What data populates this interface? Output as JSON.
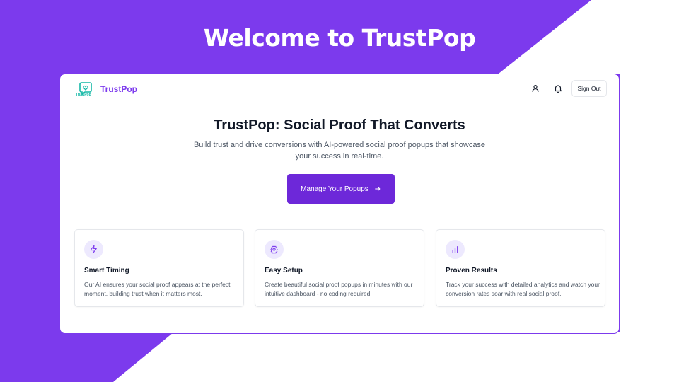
{
  "colors": {
    "accent": "#7c3aed",
    "accent_dark": "#6d28d9",
    "teal": "#14b8a6",
    "icon_bg": "#ede9fe"
  },
  "hero": {
    "title": "Welcome to TrustPop"
  },
  "header": {
    "logo_text": "TrustPop",
    "brand": "TrustPop",
    "icons": [
      "user-icon",
      "bell-icon"
    ],
    "sign_out": "Sign Out"
  },
  "main": {
    "heading": "TrustPop: Social Proof That Converts",
    "subheading": "Build trust and drive conversions with AI-powered social proof popups that showcase your success in real-time.",
    "cta_label": "Manage Your Popups",
    "cta_icon": "arrow-right-icon"
  },
  "features": [
    {
      "icon": "zap-icon",
      "title": "Smart Timing",
      "desc": "Our AI ensures your social proof appears at the perfect moment, building trust when it matters most."
    },
    {
      "icon": "gear-icon",
      "title": "Easy Setup",
      "desc": "Create beautiful social proof popups in minutes with our intuitive dashboard - no coding required."
    },
    {
      "icon": "bar-chart-icon",
      "title": "Proven Results",
      "desc": "Track your success with detailed analytics and watch your conversion rates soar with real social proof."
    }
  ]
}
